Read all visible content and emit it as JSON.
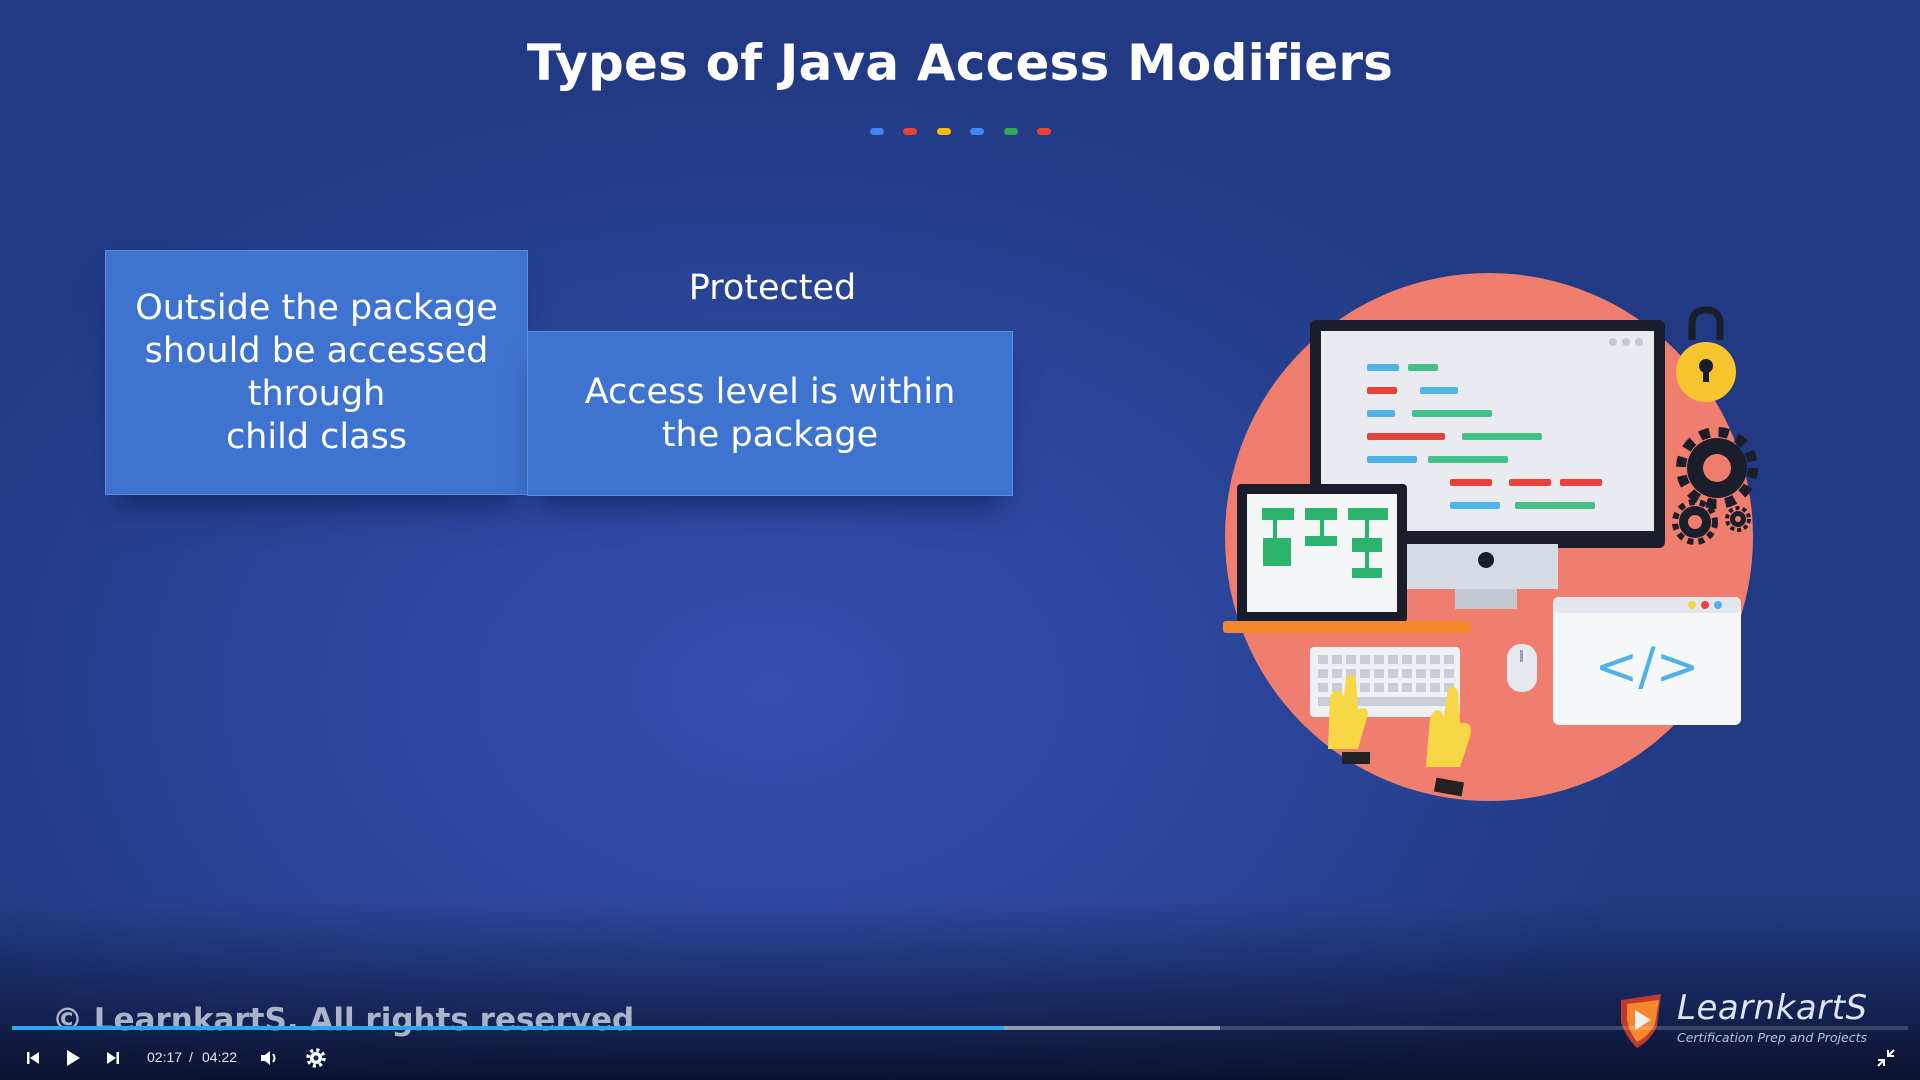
{
  "slide": {
    "title": "Types of Java Access Modifiers",
    "dot_colors": [
      "#4285f4",
      "#ea4335",
      "#fbbc05",
      "#4285f4",
      "#34a853",
      "#ea4335"
    ],
    "left_card_text": "Outside the package\nshould be accessed\nthrough\nchild class",
    "right_card_heading": "Protected",
    "right_card_text": "Access level is within\nthe package"
  },
  "watermark": {
    "copyright": "© LearnkartS. All rights reserved",
    "brand_name": "LearnkartS",
    "brand_tagline": "Certification Prep and Projects"
  },
  "player": {
    "current_time": "02:17",
    "separator": "/",
    "duration": "04:22",
    "played_fraction": 0.523,
    "buffered_fraction": 0.637,
    "accent_color": "#2aa7f0",
    "icons": [
      "skip-back-icon",
      "play-icon",
      "skip-forward-icon",
      "volume-icon",
      "settings-gear-icon",
      "exit-fullscreen-icon"
    ]
  },
  "colors": {
    "background": "#2d479f",
    "card": "#3f73d0",
    "illustration_circle": "#f07e6e"
  }
}
